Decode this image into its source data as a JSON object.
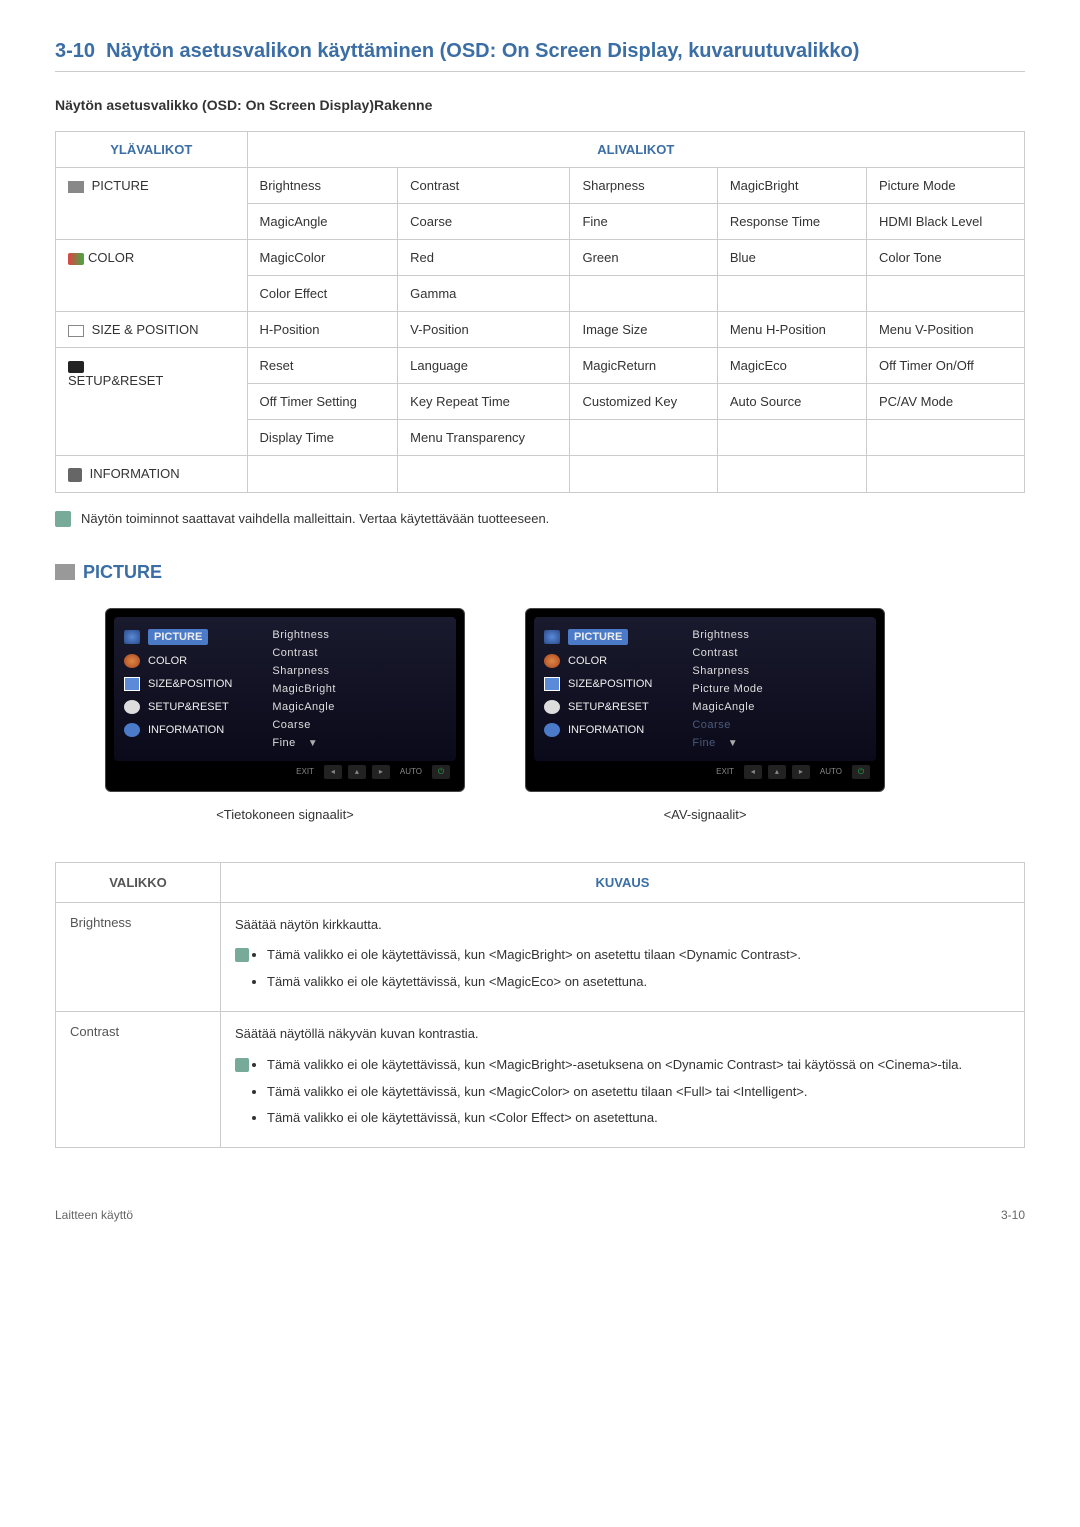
{
  "section_number": "3-10",
  "section_title": "Näytön asetusvalikon käyttäminen (OSD: On Screen Display, kuvaruutuvalikko)",
  "subtitle_prefix": "Näytön asetusvalikko (OSD: On Screen Display)",
  "subtitle_suffix": "Rakenne",
  "table_headers": {
    "main": "YLÄVALIKOT",
    "sub": "ALIVALIKOT"
  },
  "menus": {
    "picture": "PICTURE",
    "color": "COLOR",
    "size": "SIZE & POSITION",
    "setup": "SETUP&RESET",
    "info": "INFORMATION"
  },
  "picture_row1": [
    "Brightness",
    "Contrast",
    "Sharpness",
    "MagicBright",
    "Picture Mode"
  ],
  "picture_row2": [
    "MagicAngle",
    "Coarse",
    "Fine",
    "Response Time",
    "HDMI Black Level"
  ],
  "color_row1": [
    "MagicColor",
    "Red",
    "Green",
    "Blue",
    "Color Tone"
  ],
  "color_row2": [
    "Color Effect",
    "Gamma",
    "",
    "",
    ""
  ],
  "size_row": [
    "H-Position",
    "V-Position",
    "Image Size",
    "Menu H-Position",
    "Menu V-Position"
  ],
  "setup_row1": [
    "Reset",
    "Language",
    "MagicReturn",
    "MagicEco",
    "Off Timer On/Off"
  ],
  "setup_row2": [
    "Off Timer Setting",
    "Key Repeat Time",
    "Customized Key",
    "Auto Source",
    "PC/AV Mode"
  ],
  "setup_row3": [
    "Display Time",
    "Menu Transparency",
    "",
    "",
    ""
  ],
  "info_row": [
    "",
    "",
    "",
    "",
    ""
  ],
  "note1": "Näytön toiminnot saattavat vaihdella malleittain. Vertaa käytettävään tuotteeseen.",
  "picture_heading": "PICTURE",
  "osd_left": {
    "picture": "PICTURE",
    "color": "COLOR",
    "size": "SIZE&POSITION",
    "setup": "SETUP&RESET",
    "info": "INFORMATION"
  },
  "osd1_right": [
    "Brightness",
    "Contrast",
    "Sharpness",
    "MagicBright",
    "MagicAngle",
    "Coarse",
    "Fine"
  ],
  "osd2_right": [
    "Brightness",
    "Contrast",
    "Sharpness",
    "Picture Mode",
    "MagicAngle",
    "Coarse",
    "Fine"
  ],
  "osd_btn_exit": "EXIT",
  "osd_btn_auto": "AUTO",
  "caption1": "<Tietokoneen signaalit>",
  "caption2": "<AV-signaalit>",
  "desc_headers": {
    "menu": "VALIKKO",
    "desc": "KUVAUS"
  },
  "brightness": {
    "label": "Brightness",
    "intro": "Säätää näytön kirkkautta.",
    "b1": "Tämä valikko ei ole käytettävissä, kun <MagicBright> on asetettu tilaan <Dynamic Contrast>.",
    "b2": "Tämä valikko ei ole käytettävissä, kun <MagicEco> on asetettuna."
  },
  "contrast": {
    "label": "Contrast",
    "intro": "Säätää näytöllä näkyvän kuvan kontrastia.",
    "b1": "Tämä valikko ei ole käytettävissä, kun <MagicBright>-asetuksena on <Dynamic Contrast> tai käytössä on <Cinema>-tila.",
    "b2": "Tämä valikko ei ole käytettävissä, kun <MagicColor> on asetettu tilaan <Full> tai <Intelligent>.",
    "b3": "Tämä valikko ei ole käytettävissä, kun <Color Effect> on asetettuna."
  },
  "footer_left": "Laitteen käyttö",
  "footer_right": "3-10"
}
